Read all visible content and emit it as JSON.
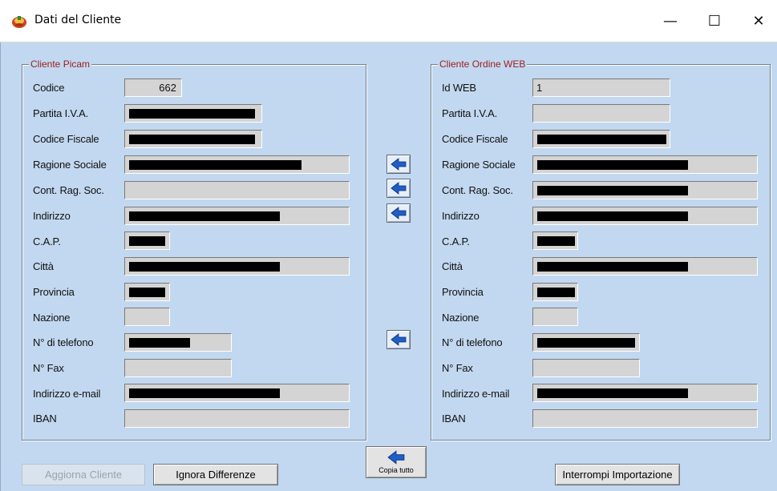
{
  "window": {
    "title": "Dati del Cliente",
    "minimize_glyph": "—",
    "maximize_glyph": "☐",
    "close_glyph": "✕",
    "icon": "picam-app-icon"
  },
  "left_group": {
    "title": "Cliente Picam",
    "fields": [
      {
        "label": "Codice",
        "value": "662",
        "redacted": false
      },
      {
        "label": "Partita I.V.A.",
        "value": "",
        "redacted": true
      },
      {
        "label": "Codice Fiscale",
        "value": "",
        "redacted": true
      },
      {
        "label": "Ragione Sociale",
        "value": "",
        "redacted": true
      },
      {
        "label": "Cont. Rag. Soc.",
        "value": "",
        "redacted": false
      },
      {
        "label": "Indirizzo",
        "value": "",
        "redacted": true
      },
      {
        "label": "C.A.P.",
        "value": "",
        "redacted": true
      },
      {
        "label": "Città",
        "value": "",
        "redacted": true
      },
      {
        "label": "Provincia",
        "value": "",
        "redacted": true
      },
      {
        "label": "Nazione",
        "value": "",
        "redacted": false
      },
      {
        "label": "N° di telefono",
        "value": "",
        "redacted": true
      },
      {
        "label": "N° Fax",
        "value": "",
        "redacted": false
      },
      {
        "label": "Indirizzo e-mail",
        "value": "",
        "redacted": true
      },
      {
        "label": "IBAN",
        "value": "",
        "redacted": false
      }
    ]
  },
  "right_group": {
    "title": "Cliente Ordine WEB",
    "fields": [
      {
        "label": "Id WEB",
        "value": "1",
        "redacted": false
      },
      {
        "label": "Partita I.V.A.",
        "value": "",
        "redacted": false
      },
      {
        "label": "Codice Fiscale",
        "value": "",
        "redacted": true
      },
      {
        "label": "Ragione Sociale",
        "value": "",
        "redacted": true
      },
      {
        "label": "Cont. Rag. Soc.",
        "value": "",
        "redacted": true
      },
      {
        "label": "Indirizzo",
        "value": "",
        "redacted": true
      },
      {
        "label": "C.A.P.",
        "value": "",
        "redacted": true
      },
      {
        "label": "Città",
        "value": "",
        "redacted": true
      },
      {
        "label": "Provincia",
        "value": "",
        "redacted": true
      },
      {
        "label": "Nazione",
        "value": "",
        "redacted": false
      },
      {
        "label": "N° di telefono",
        "value": "",
        "redacted": true
      },
      {
        "label": "N° Fax",
        "value": "",
        "redacted": false
      },
      {
        "label": "Indirizzo e-mail",
        "value": "",
        "redacted": true
      },
      {
        "label": "IBAN",
        "value": "",
        "redacted": false
      }
    ]
  },
  "copy_arrows": {
    "icon": "arrow-left-icon",
    "rows": [
      "Ragione Sociale",
      "Cont. Rag. Soc.",
      "Indirizzo",
      "N° di telefono"
    ]
  },
  "buttons": {
    "update_client": "Aggiorna Cliente",
    "ignore_differences": "Ignora Differenze",
    "copy_all": "Copia tutto",
    "stop_import": "Interrompi Importazione"
  },
  "colors": {
    "background": "#c2d8f0",
    "group_title": "#9b1c1c",
    "field_bg": "#d4d4d4",
    "arrow_blue": "#1f5fc8"
  }
}
